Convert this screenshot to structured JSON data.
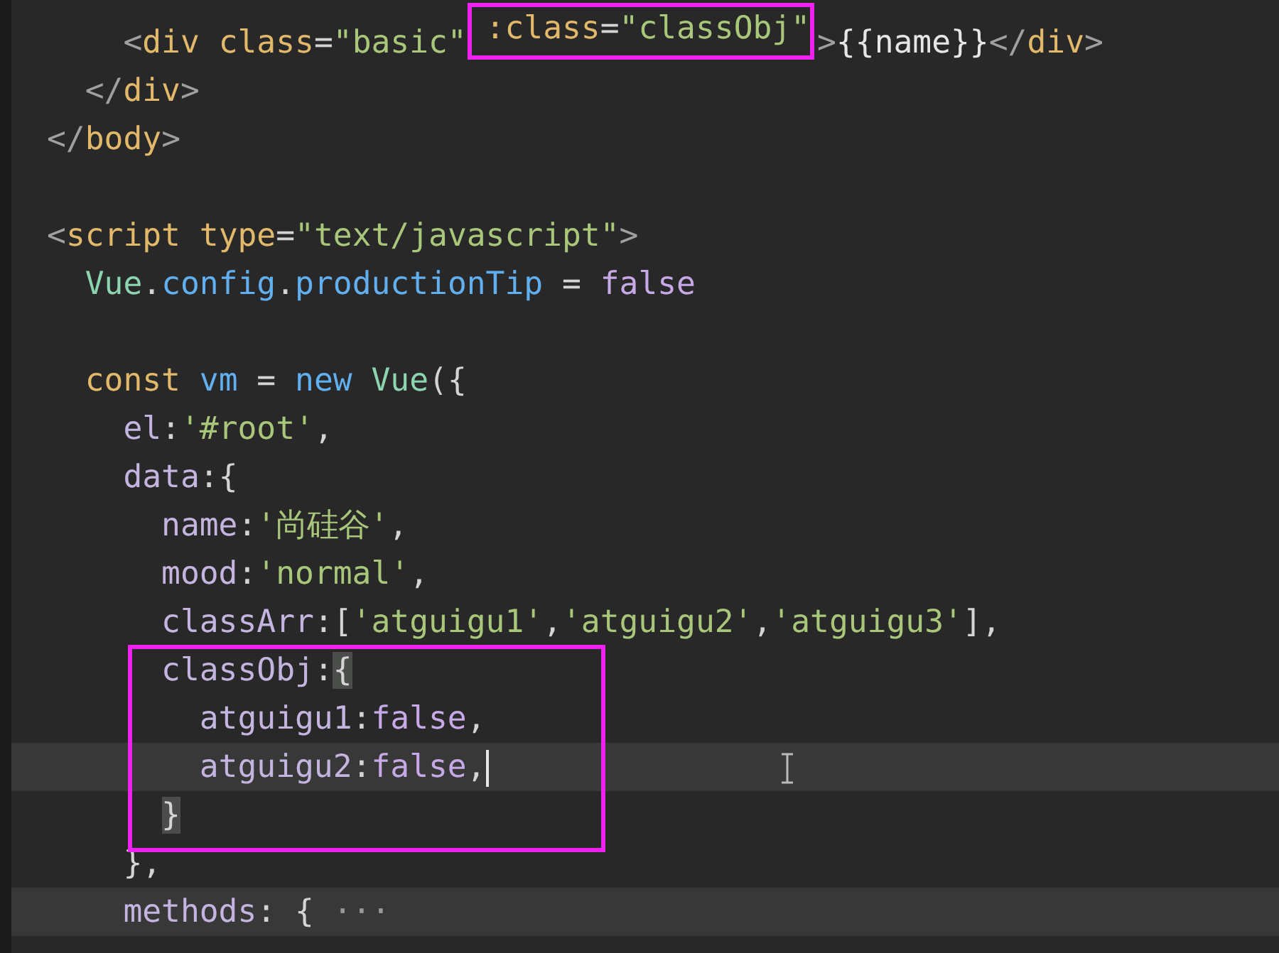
{
  "editor": {
    "lines": [
      {
        "kind": "group",
        "children": [
          {
            "kind": "group",
            "children": [
              {
                "kind": "line",
                "highlighted": false,
                "tokens": [
                  {
                    "kind": "angle",
                    "text": "<"
                  },
                  {
                    "kind": "tag",
                    "text": "div "
                  },
                  {
                    "kind": "attr",
                    "text": "class"
                  },
                  {
                    "kind": "punct",
                    "text": "="
                  },
                  {
                    "kind": "str",
                    "text": "\"basic\" "
                  },
                  {
                    "kind": "box",
                    "tokens": [
                      {
                        "kind": "attr",
                        "text": ":class"
                      },
                      {
                        "kind": "punct",
                        "text": "="
                      },
                      {
                        "kind": "str",
                        "text": "\"classObj\""
                      }
                    ]
                  },
                  {
                    "kind": "angle",
                    "text": ">"
                  },
                  {
                    "kind": "text",
                    "text": "{{name}}"
                  },
                  {
                    "kind": "angle",
                    "text": "</"
                  },
                  {
                    "kind": "tag",
                    "text": "div"
                  },
                  {
                    "kind": "angle",
                    "text": ">"
                  }
                ]
              }
            ]
          },
          {
            "kind": "line",
            "highlighted": false,
            "tokens": [
              {
                "kind": "angle",
                "text": "</"
              },
              {
                "kind": "tag",
                "text": "div"
              },
              {
                "kind": "angle",
                "text": ">"
              }
            ]
          }
        ]
      },
      {
        "kind": "line",
        "highlighted": false,
        "tokens": [
          {
            "kind": "angle",
            "text": "</"
          },
          {
            "kind": "tag",
            "text": "body"
          },
          {
            "kind": "angle",
            "text": ">"
          }
        ]
      },
      {
        "kind": "blank"
      },
      {
        "kind": "line",
        "highlighted": false,
        "tokens": [
          {
            "kind": "angle",
            "text": "<"
          },
          {
            "kind": "tag",
            "text": "script "
          },
          {
            "kind": "attr",
            "text": "type"
          },
          {
            "kind": "punct",
            "text": "="
          },
          {
            "kind": "str",
            "text": "\"text/javascript\""
          },
          {
            "kind": "angle",
            "text": ">"
          }
        ],
        "children": [
          {
            "kind": "line",
            "highlighted": false,
            "tokens": [
              {
                "kind": "cls",
                "text": "Vue"
              },
              {
                "kind": "punct",
                "text": "."
              },
              {
                "kind": "prop",
                "text": "config"
              },
              {
                "kind": "punct",
                "text": "."
              },
              {
                "kind": "prop",
                "text": "productionTip "
              },
              {
                "kind": "punct",
                "text": "= "
              },
              {
                "kind": "bool",
                "text": "false"
              }
            ]
          },
          {
            "kind": "blank"
          },
          {
            "kind": "line",
            "highlighted": false,
            "tokens": [
              {
                "kind": "kw",
                "text": "const "
              },
              {
                "kind": "var",
                "text": "vm "
              },
              {
                "kind": "punct",
                "text": "= "
              },
              {
                "kind": "var",
                "text": "new "
              },
              {
                "kind": "cls",
                "text": "Vue"
              },
              {
                "kind": "punct",
                "text": "({"
              }
            ],
            "children": [
              {
                "kind": "line",
                "highlighted": false,
                "tokens": [
                  {
                    "kind": "key",
                    "text": "el"
                  },
                  {
                    "kind": "punct",
                    "text": ":"
                  },
                  {
                    "kind": "str",
                    "text": "'#root'"
                  },
                  {
                    "kind": "punct",
                    "text": ","
                  }
                ]
              },
              {
                "kind": "line",
                "highlighted": false,
                "tokens": [
                  {
                    "kind": "key",
                    "text": "data"
                  },
                  {
                    "kind": "punct",
                    "text": ":{"
                  }
                ],
                "children": [
                  {
                    "kind": "line",
                    "highlighted": false,
                    "tokens": [
                      {
                        "kind": "key",
                        "text": "name"
                      },
                      {
                        "kind": "punct",
                        "text": ":"
                      },
                      {
                        "kind": "str",
                        "text": "'尚硅谷'"
                      },
                      {
                        "kind": "punct",
                        "text": ","
                      }
                    ]
                  },
                  {
                    "kind": "line",
                    "highlighted": false,
                    "tokens": [
                      {
                        "kind": "key",
                        "text": "mood"
                      },
                      {
                        "kind": "punct",
                        "text": ":"
                      },
                      {
                        "kind": "str",
                        "text": "'normal'"
                      },
                      {
                        "kind": "punct",
                        "text": ","
                      }
                    ]
                  },
                  {
                    "kind": "line",
                    "highlighted": false,
                    "tokens": [
                      {
                        "kind": "key",
                        "text": "classArr"
                      },
                      {
                        "kind": "punct",
                        "text": ":["
                      },
                      {
                        "kind": "str",
                        "text": "'atguigu1'"
                      },
                      {
                        "kind": "punct",
                        "text": ","
                      },
                      {
                        "kind": "str",
                        "text": "'atguigu2'"
                      },
                      {
                        "kind": "punct",
                        "text": ","
                      },
                      {
                        "kind": "str",
                        "text": "'atguigu3'"
                      },
                      {
                        "kind": "punct",
                        "text": "],"
                      }
                    ]
                  },
                  {
                    "kind": "box",
                    "children": [
                      {
                        "kind": "line",
                        "highlighted": false,
                        "tokens": [
                          {
                            "kind": "key",
                            "text": "classObj"
                          },
                          {
                            "kind": "punct",
                            "text": ":"
                          },
                          {
                            "kind": "match",
                            "text": "{"
                          }
                        ],
                        "children": [
                          {
                            "kind": "line",
                            "highlighted": false,
                            "tokens": [
                              {
                                "kind": "key",
                                "text": "atguigu1"
                              },
                              {
                                "kind": "punct",
                                "text": ":"
                              },
                              {
                                "kind": "bool",
                                "text": "false"
                              },
                              {
                                "kind": "punct",
                                "text": ","
                              }
                            ]
                          },
                          {
                            "kind": "line",
                            "highlighted": true,
                            "tokens": [
                              {
                                "kind": "key",
                                "text": "atguigu2"
                              },
                              {
                                "kind": "punct",
                                "text": ":"
                              },
                              {
                                "kind": "bool",
                                "text": "false"
                              },
                              {
                                "kind": "punct",
                                "text": ","
                              },
                              {
                                "kind": "caret"
                              },
                              {
                                "kind": "pointer"
                              }
                            ]
                          }
                        ]
                      },
                      {
                        "kind": "line",
                        "highlighted": false,
                        "tokens": [
                          {
                            "kind": "match",
                            "text": "}"
                          }
                        ]
                      }
                    ]
                  }
                ]
              },
              {
                "kind": "line",
                "highlighted": false,
                "tokens": [
                  {
                    "kind": "punct",
                    "text": "},"
                  }
                ]
              },
              {
                "kind": "line",
                "highlighted": true,
                "tokens": [
                  {
                    "kind": "key",
                    "text": "methods"
                  },
                  {
                    "kind": "punct",
                    "text": ": { "
                  },
                  {
                    "kind": "fold",
                    "text": "···"
                  }
                ]
              }
            ]
          }
        ]
      }
    ]
  }
}
